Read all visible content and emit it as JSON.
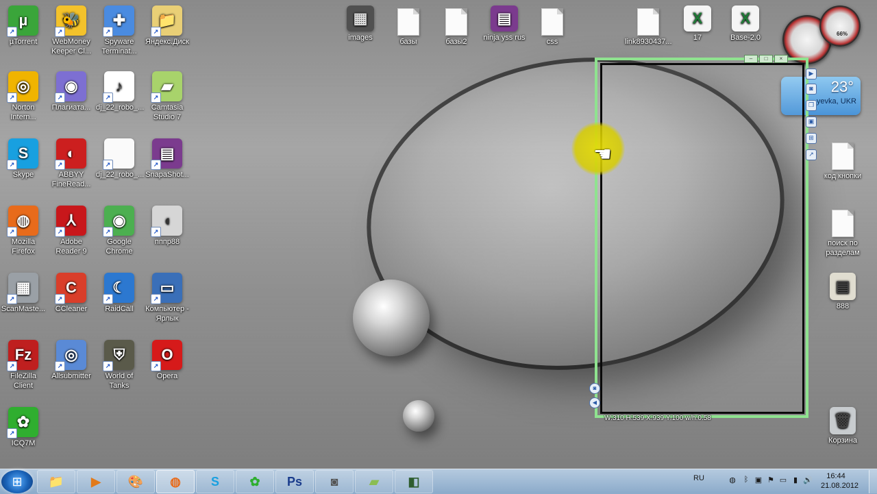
{
  "desktop": {
    "left_icons": [
      {
        "label": "µTorrent",
        "icon": "utorrent-icon",
        "glyph": "µ",
        "bg": "#3aa53a"
      },
      {
        "label": "WebMoney Keeper Cl...",
        "icon": "webmoney-icon",
        "glyph": "🐝",
        "bg": "#f3c22b"
      },
      {
        "label": "Spyware Terminat...",
        "icon": "shield-icon",
        "glyph": "✚",
        "bg": "#4a8be0"
      },
      {
        "label": "Яндекс.Диск",
        "icon": "folder-icon",
        "glyph": "📁",
        "bg": "#e9cf76"
      },
      {
        "label": "Norton Intern...",
        "icon": "norton-icon",
        "glyph": "◎",
        "bg": "#f0b400"
      },
      {
        "label": "Плагиата...",
        "icon": "plagiat-icon",
        "glyph": "◉",
        "bg": "#7d6fd2"
      },
      {
        "label": "dj_22_robo_...",
        "icon": "mp3-file-icon",
        "glyph": "♪",
        "bg": "#ffffff"
      },
      {
        "label": "Camtasia Studio 7",
        "icon": "camtasia-icon",
        "glyph": "▰",
        "bg": "#a8d36b"
      },
      {
        "label": "Skype",
        "icon": "skype-icon",
        "glyph": "S",
        "bg": "#18a0e0"
      },
      {
        "label": "ABBYY FineRead...",
        "icon": "abbyy-icon",
        "glyph": "◐",
        "bg": "#cc1f1f"
      },
      {
        "label": "dj_22_robo_...",
        "icon": "blank-file-icon",
        "glyph": "",
        "bg": "#fafafa"
      },
      {
        "label": "SnapaShot...",
        "icon": "winrar-icon",
        "glyph": "▤",
        "bg": "#7b3b8e"
      },
      {
        "label": "Mozilla Firefox",
        "icon": "firefox-icon",
        "glyph": "◍",
        "bg": "#e86b1b"
      },
      {
        "label": "Adobe Reader 9",
        "icon": "adobe-reader-icon",
        "glyph": "⅄",
        "bg": "#c8171b"
      },
      {
        "label": "Google Chrome",
        "icon": "chrome-icon",
        "glyph": "◉",
        "bg": "#4caf50"
      },
      {
        "label": "пппр88",
        "icon": "toggle-icon",
        "glyph": "◖",
        "bg": "#d6d6d6"
      },
      {
        "label": "ScanMaste...",
        "icon": "chip-icon",
        "glyph": "▦",
        "bg": "#9aa0a6"
      },
      {
        "label": "CCleaner",
        "icon": "ccleaner-icon",
        "glyph": "C",
        "bg": "#d93e2a"
      },
      {
        "label": "RaidCall",
        "icon": "raidcall-icon",
        "glyph": "☾",
        "bg": "#2c78d0"
      },
      {
        "label": "Компьютер - Ярлык",
        "icon": "computer-icon",
        "glyph": "▭",
        "bg": "#3a6fb8"
      },
      {
        "label": "FileZilla Client",
        "icon": "filezilla-icon",
        "glyph": "Fz",
        "bg": "#bf1f1f"
      },
      {
        "label": "Allsubmitter",
        "icon": "allsubmitter-icon",
        "glyph": "◎",
        "bg": "#5a8ad6"
      },
      {
        "label": "World of Tanks",
        "icon": "wot-icon",
        "glyph": "⛨",
        "bg": "#5a5a4a"
      },
      {
        "label": "Opera",
        "icon": "opera-icon",
        "glyph": "O",
        "bg": "#d61a1a"
      },
      {
        "label": "ICQ7M",
        "icon": "icq-icon",
        "glyph": "✿",
        "bg": "#2fae2f"
      }
    ],
    "top_icons": [
      {
        "label": "images",
        "icon": "folder-images-icon",
        "kind": "folder"
      },
      {
        "label": "базы",
        "icon": "file-icon",
        "kind": "file"
      },
      {
        "label": "базы2",
        "icon": "file-icon",
        "kind": "file"
      },
      {
        "label": "ninja yss rus",
        "icon": "winrar-icon",
        "kind": "archive"
      },
      {
        "label": "css",
        "icon": "file-icon",
        "kind": "file"
      },
      {
        "label": "link8930437...",
        "icon": "file-icon",
        "kind": "file"
      },
      {
        "label": "17",
        "icon": "excel-file-icon",
        "kind": "excel"
      },
      {
        "label": "Base-2.0",
        "icon": "excel-file-icon",
        "kind": "excel"
      }
    ],
    "right_icons": [
      {
        "label": "код кнопки",
        "icon": "file-icon",
        "kind": "file"
      },
      {
        "label": "поиск по разделам",
        "icon": "file-icon",
        "kind": "file"
      },
      {
        "label": "888",
        "icon": "image-file-icon",
        "kind": "image"
      },
      {
        "label": "Корзина",
        "icon": "recycle-bin-icon",
        "kind": "bin"
      }
    ]
  },
  "capture": {
    "dimensions_text": "W:310 H:539 X:939 Y:100 w/h:0.58",
    "btn_min": "–",
    "btn_max": "□",
    "btn_close": "×"
  },
  "gadgets": {
    "gauge_percent": "66%",
    "weather_temp": "23°",
    "weather_location": "yevka, UKR"
  },
  "taskbar": {
    "language": "RU",
    "time": "16:44",
    "date": "21.08.2012",
    "apps": [
      "explorer-icon",
      "media-player-icon",
      "paint-icon",
      "firefox-icon",
      "skype-icon",
      "icq-icon",
      "photoshop-icon",
      "camera-icon",
      "camtasia-icon",
      "recorder-icon"
    ]
  },
  "colors": {
    "capture_border": "#8fe38f",
    "cursor_highlight": "#e6dc00"
  }
}
